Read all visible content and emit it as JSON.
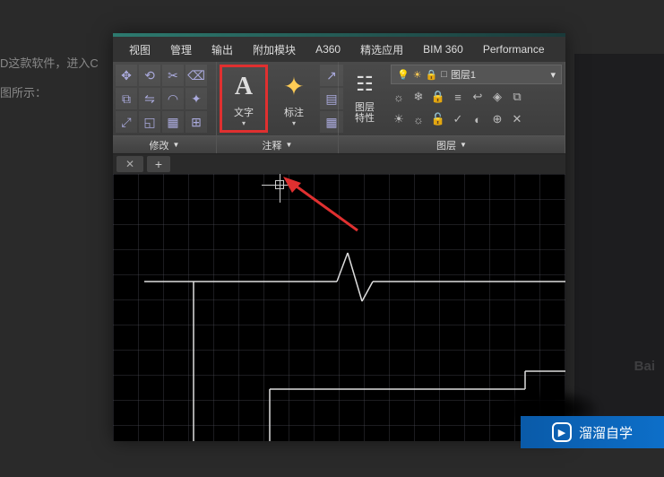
{
  "page": {
    "line1": "D这款软件，进入C",
    "line2": "图所示："
  },
  "menu": {
    "view": "视图",
    "manage": "管理",
    "output": "输出",
    "addins": "附加模块",
    "a360": "A360",
    "featured": "精选应用",
    "bim360": "BIM 360",
    "performance": "Performance"
  },
  "ribbon": {
    "modify_label": "修改",
    "annotate_label": "注释",
    "layers_label": "图层",
    "text_label": "文字",
    "dim_label": "标注",
    "layerprops_label": "图层\n特性"
  },
  "layer": {
    "current": "图层1"
  },
  "icons": {
    "text": "A"
  },
  "watermark": {
    "label": "溜溜自学"
  },
  "baidu": "Bai"
}
